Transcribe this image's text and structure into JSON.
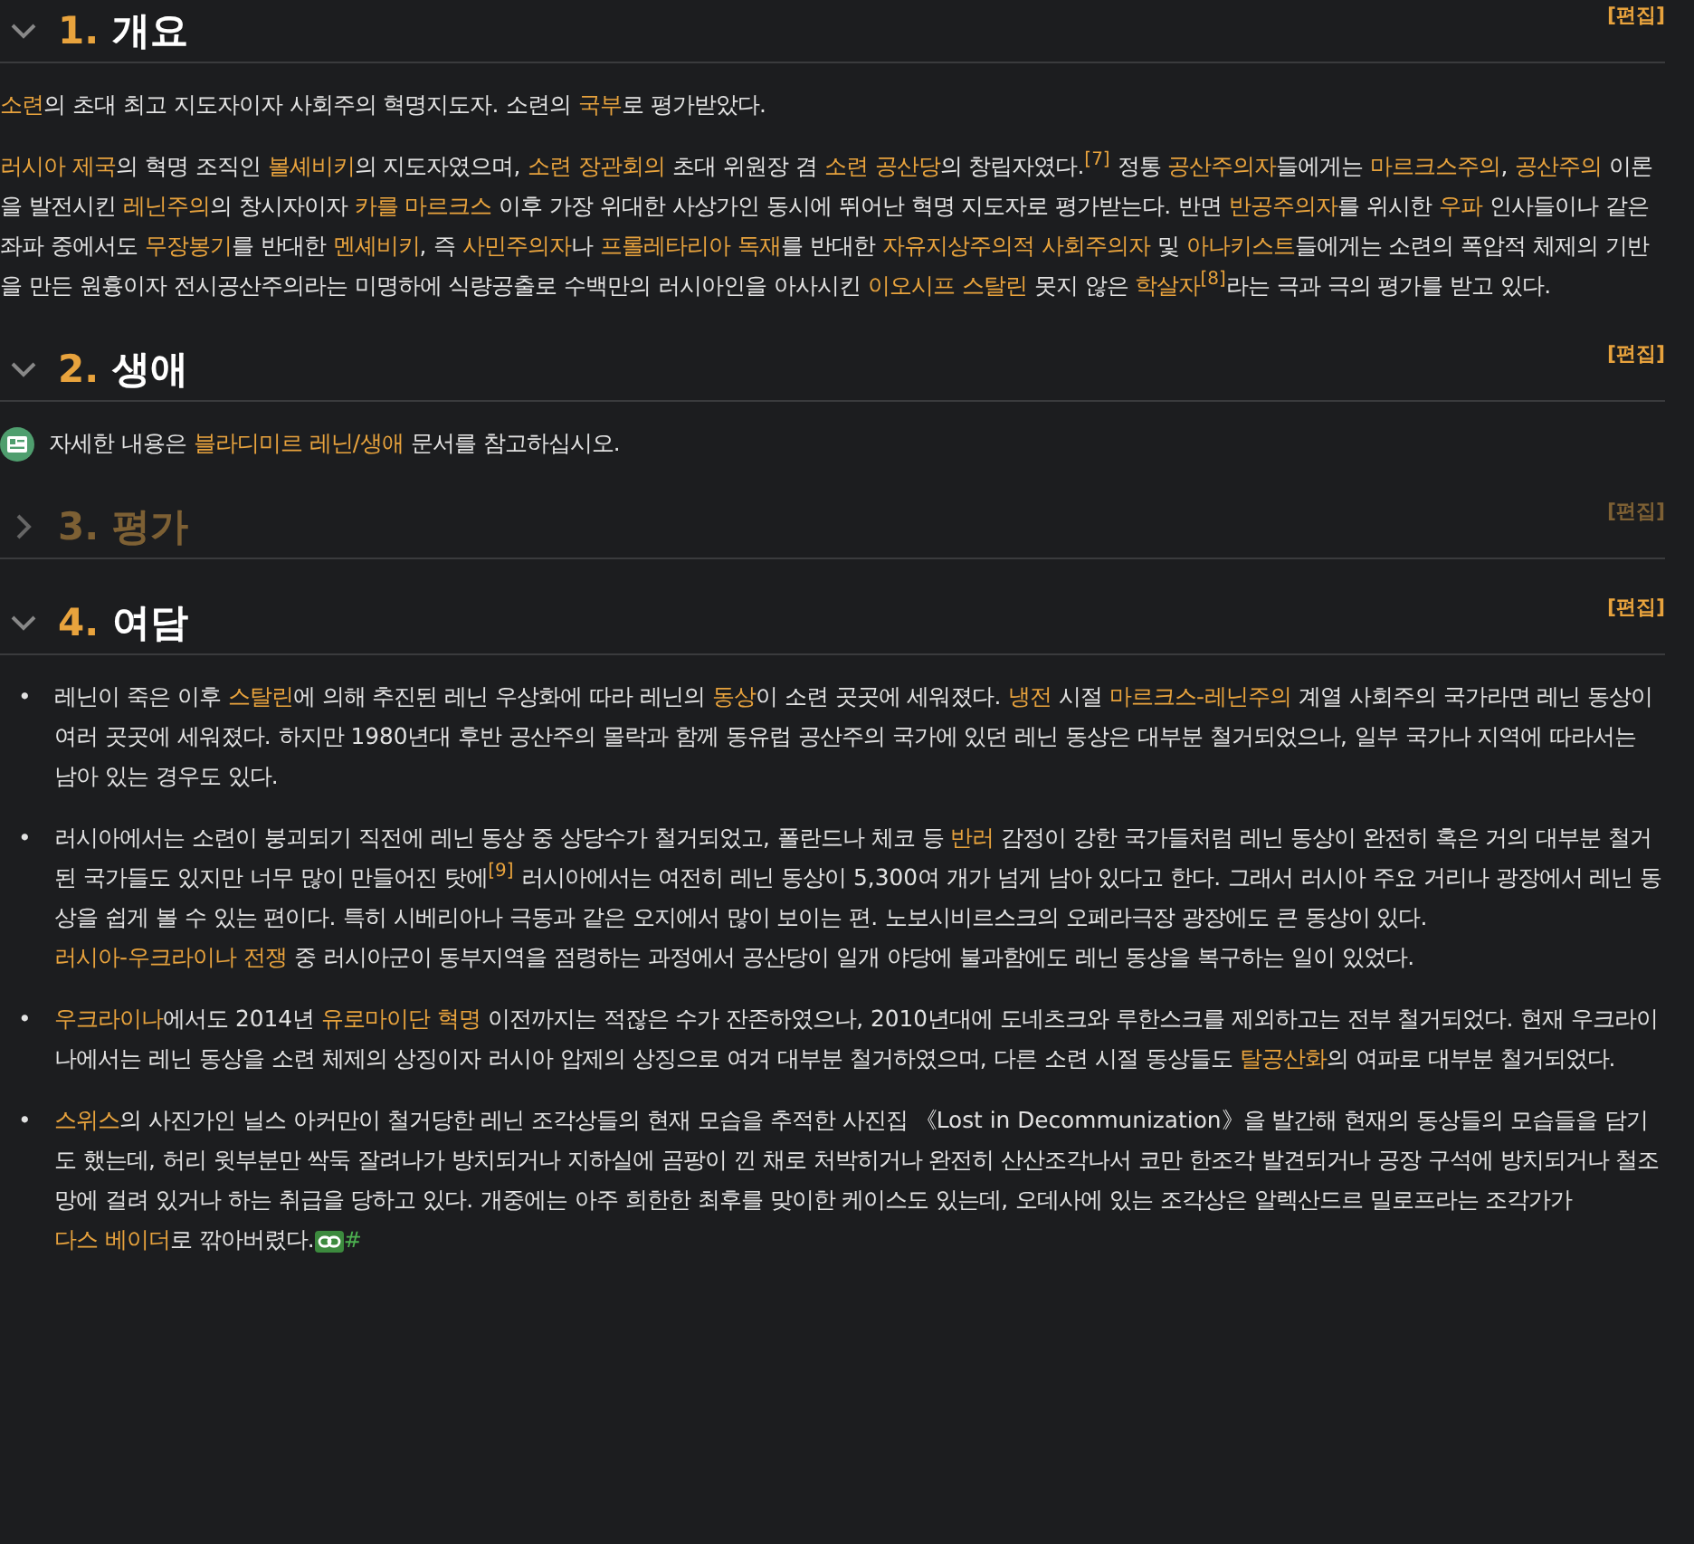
{
  "sections": [
    {
      "number": "1.",
      "title": "개요",
      "expanded": true,
      "edit": "[편집]",
      "blocks": [
        {
          "kind": "paragraph",
          "parts": [
            {
              "kind": "link",
              "text": "소련"
            },
            {
              "kind": "plain",
              "text": "의 초대 최고 지도자이자 사회주의 혁명지도자. 소련의 "
            },
            {
              "kind": "link",
              "text": "국부"
            },
            {
              "kind": "plain",
              "text": "로 평가받았다."
            }
          ]
        },
        {
          "kind": "paragraph",
          "parts": [
            {
              "kind": "link",
              "text": "러시아 제국"
            },
            {
              "kind": "plain",
              "text": "의 혁명 조직인 "
            },
            {
              "kind": "link",
              "text": "볼셰비키"
            },
            {
              "kind": "plain",
              "text": "의 지도자였으며, "
            },
            {
              "kind": "link",
              "text": "소련 장관회의"
            },
            {
              "kind": "plain",
              "text": " 초대 위원장 겸 "
            },
            {
              "kind": "link",
              "text": "소련 공산당"
            },
            {
              "kind": "plain",
              "text": "의 창립자였다."
            },
            {
              "kind": "ref",
              "text": "[7]"
            },
            {
              "kind": "plain",
              "text": " 정통 "
            },
            {
              "kind": "link",
              "text": "공산주의자"
            },
            {
              "kind": "plain",
              "text": "들에게는 "
            },
            {
              "kind": "link",
              "text": "마르크스주의"
            },
            {
              "kind": "plain",
              "text": ", "
            },
            {
              "kind": "link",
              "text": "공산주의"
            },
            {
              "kind": "plain",
              "text": " 이론을 발전시킨 "
            },
            {
              "kind": "link",
              "text": "레닌주의"
            },
            {
              "kind": "plain",
              "text": "의 창시자이자 "
            },
            {
              "kind": "link",
              "text": "카를 마르크스"
            },
            {
              "kind": "plain",
              "text": " 이후 가장 위대한 사상가인 동시에 뛰어난 혁명 지도자로 평가받는다. 반면 "
            },
            {
              "kind": "link",
              "text": "반공주의자"
            },
            {
              "kind": "plain",
              "text": "를 위시한 "
            },
            {
              "kind": "link",
              "text": "우파"
            },
            {
              "kind": "plain",
              "text": " 인사들이나 같은 좌파 중에서도 "
            },
            {
              "kind": "link",
              "text": "무장봉기"
            },
            {
              "kind": "plain",
              "text": "를 반대한 "
            },
            {
              "kind": "link",
              "text": "멘셰비키"
            },
            {
              "kind": "plain",
              "text": ", 즉 "
            },
            {
              "kind": "link",
              "text": "사민주의자"
            },
            {
              "kind": "plain",
              "text": "나 "
            },
            {
              "kind": "link",
              "text": "프롤레타리아 독재"
            },
            {
              "kind": "plain",
              "text": "를 반대한 "
            },
            {
              "kind": "link",
              "text": "자유지상주의적 사회주의자"
            },
            {
              "kind": "plain",
              "text": " 및 "
            },
            {
              "kind": "link",
              "text": "아나키스트"
            },
            {
              "kind": "plain",
              "text": "들에게는 소련의 폭압적 체제의 기반을 만든 원흉이자 전시공산주의라는 미명하에 식량공출로 수백만의 러시아인을 아사시킨 "
            },
            {
              "kind": "link",
              "text": "이오시프 스탈린"
            },
            {
              "kind": "plain",
              "text": " 못지 않은 "
            },
            {
              "kind": "link",
              "text": "학살자"
            },
            {
              "kind": "ref",
              "text": "[8]"
            },
            {
              "kind": "plain",
              "text": "라는 극과 극의 평가를 받고 있다."
            }
          ]
        }
      ]
    },
    {
      "number": "2.",
      "title": "생애",
      "expanded": true,
      "edit": "[편집]",
      "blocks": [
        {
          "kind": "notice",
          "parts": [
            {
              "kind": "plain",
              "text": "자세한 내용은 "
            },
            {
              "kind": "link",
              "text": "블라디미르 레닌/생애"
            },
            {
              "kind": "plain",
              "text": " 문서를 참고하십시오."
            }
          ]
        }
      ]
    },
    {
      "number": "3.",
      "title": "평가",
      "expanded": false,
      "edit": "[편집]"
    },
    {
      "number": "4.",
      "title": "여담",
      "expanded": true,
      "edit": "[편집]",
      "blocks": [
        {
          "kind": "bullets",
          "items": [
            {
              "marker": "•",
              "parts": [
                {
                  "kind": "plain",
                  "text": "레닌이 죽은 이후 "
                },
                {
                  "kind": "link",
                  "text": "스탈린"
                },
                {
                  "kind": "plain",
                  "text": "에 의해 추진된 레닌 우상화에 따라 레닌의 "
                },
                {
                  "kind": "link",
                  "text": "동상"
                },
                {
                  "kind": "plain",
                  "text": "이 소련 곳곳에 세워졌다. "
                },
                {
                  "kind": "link",
                  "text": "냉전"
                },
                {
                  "kind": "plain",
                  "text": " 시절 "
                },
                {
                  "kind": "link",
                  "text": "마르크스-레닌주의"
                },
                {
                  "kind": "plain",
                  "text": " 계열 사회주의 국가라면 레닌 동상이 여러 곳곳에 세워졌다. 하지만 1980년대 후반 공산주의 몰락과 함께 동유럽 공산주의 국가에 있던 레닌 동상은 대부분 철거되었으나, 일부 국가나 지역에 따라서는 남아 있는 경우도 있다."
                }
              ]
            },
            {
              "marker": "•",
              "parts": [
                {
                  "kind": "plain",
                  "text": "러시아에서는 소련이 붕괴되기 직전에 레닌 동상 중 상당수가 철거되었고, 폴란드나 체코 등 "
                },
                {
                  "kind": "link",
                  "text": "반러"
                },
                {
                  "kind": "plain",
                  "text": " 감정이 강한 국가들처럼 레닌 동상이 완전히 혹은 거의 대부분 철거된 국가들도 있지만 너무 많이 만들어진 탓에"
                },
                {
                  "kind": "ref",
                  "text": "[9]"
                },
                {
                  "kind": "plain",
                  "text": " 러시아에서는 여전히 레닌 동상이 5,300여 개가 넘게 남아 있다고 한다. 그래서 러시아 주요 거리나 광장에서 레닌 동상을 쉽게 볼 수 있는 편이다. 특히 시베리아나 극동과 같은 오지에서 많이 보이는 편. 노보시비르스크의 오페라극장 광장에도 큰 동상이 있다. "
                },
                {
                  "kind": "link",
                  "text": "러시아-우크라이나 전쟁"
                },
                {
                  "kind": "plain",
                  "text": " 중 러시아군이 동부지역을 점령하는 과정에서 공산당이 일개 야당에 불과함에도 레닌 동상을 복구하는 일이 있었다."
                }
              ]
            },
            {
              "marker": "•",
              "parts": [
                {
                  "kind": "link",
                  "text": "우크라이나"
                },
                {
                  "kind": "plain",
                  "text": "에서도 2014년 "
                },
                {
                  "kind": "link",
                  "text": "유로마이단 혁명"
                },
                {
                  "kind": "plain",
                  "text": " 이전까지는 적잖은 수가 잔존하였으나, 2010년대에 도네츠크와 루한스크를 제외하고는 전부 철거되었다. 현재 우크라이나에서는 레닌 동상을 소련 체제의 상징이자 러시아 압제의 상징으로 여겨 대부분 철거하였으며, 다른 소련 시절 동상들도 "
                },
                {
                  "kind": "link",
                  "text": "탈공산화"
                },
                {
                  "kind": "plain",
                  "text": "의 여파로 대부분 철거되었다."
                }
              ]
            },
            {
              "marker": "•",
              "parts": [
                {
                  "kind": "link",
                  "text": "스위스"
                },
                {
                  "kind": "plain",
                  "text": "의 사진가인 닐스 아커만이 철거당한 레닌 조각상들의 현재 모습을 추적한 사진집 《Lost in Decommunization》을 발간해 현재의 동상들의 모습들을 담기도 했는데, 허리 윗부분만 싹둑 잘려나가 방치되거나 지하실에 곰팡이 낀 채로 처박히거나 완전히 산산조각나서 코만 한조각 발견되거나 공장 구석에 방치되거나 철조망에 걸려 있거나 하는 취급을 당하고 있다. 개중에는 아주 희한한 최후를 맞이한 케이스도 있는데, 오데사에 있는 조각상은 알렉산드르 밀로프라는 조각가가 "
                },
                {
                  "kind": "link",
                  "text": "다스 베이더"
                },
                {
                  "kind": "plain",
                  "text": "로 깎아버렸다."
                },
                {
                  "kind": "anchor",
                  "text": "#"
                }
              ]
            }
          ]
        }
      ]
    }
  ]
}
